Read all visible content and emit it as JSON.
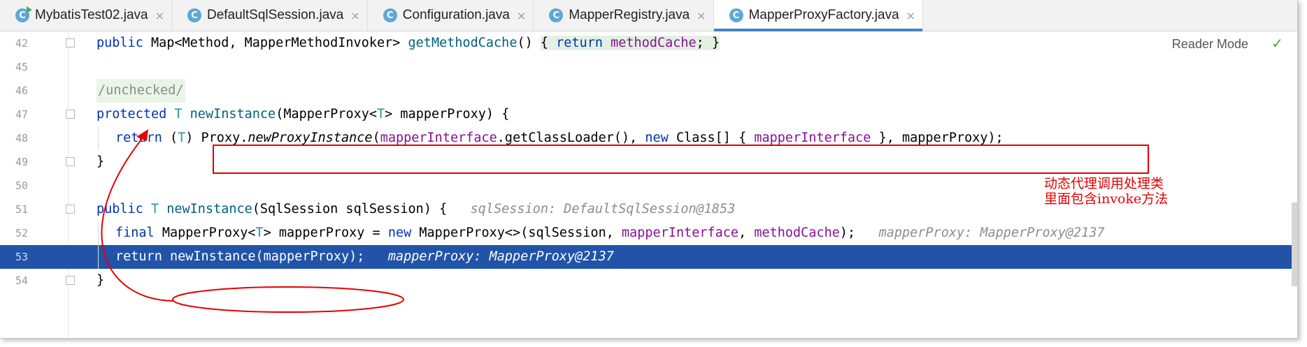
{
  "tabs": [
    {
      "label": "MybatisTest02.java",
      "active": false,
      "icon": "class-run-icon"
    },
    {
      "label": "DefaultSqlSession.java",
      "active": false,
      "icon": "class-icon"
    },
    {
      "label": "Configuration.java",
      "active": false,
      "icon": "class-icon"
    },
    {
      "label": "MapperRegistry.java",
      "active": false,
      "icon": "class-icon"
    },
    {
      "label": "MapperProxyFactory.java",
      "active": true,
      "icon": "class-icon"
    }
  ],
  "tab_icon_letter": "C",
  "tab_close_glyph": "×",
  "reader_mode": "Reader Mode",
  "inspection_icon": "check-icon",
  "lines": {
    "l42": {
      "num": "42",
      "a": "public ",
      "b": "Map<Method, MapperMethodInvoker> ",
      "c": "getMethodCache",
      "d": "() ",
      "e": "{ ",
      "f": "return ",
      "g": "methodCache",
      "h": "; }"
    },
    "l45": {
      "num": "45"
    },
    "l46": {
      "num": "46",
      "comment": "/unchecked/"
    },
    "l47": {
      "num": "47",
      "a": "protected ",
      "b": "T ",
      "c": "newInstance",
      "d": "(MapperProxy<",
      "e": "T",
      "f": "> mapperProxy) {"
    },
    "l48": {
      "num": "48",
      "a": "return ",
      "b": "(",
      "c": "T",
      "d": ") ",
      "e": "Proxy.",
      "f": "newProxyInstance",
      "g": "(",
      "h": "mapperInterface",
      "i": ".getClassLoader(), ",
      "j": "new ",
      "k": "Class[] { ",
      "l": "mapperInterface",
      "m": " }, mapperProxy);"
    },
    "l49": {
      "num": "49",
      "a": "}"
    },
    "l50": {
      "num": "50"
    },
    "l51": {
      "num": "51",
      "a": "public ",
      "b": "T ",
      "c": "newInstance",
      "d": "(SqlSession sqlSession) {",
      "hint": "sqlSession: DefaultSqlSession@1853"
    },
    "l52": {
      "num": "52",
      "a": "final ",
      "b": "MapperProxy<",
      "c": "T",
      "d": "> mapperProxy = ",
      "e": "new ",
      "f": "MapperProxy<>(sqlSession, ",
      "g": "mapperInterface",
      "h": ", ",
      "i": "methodCache",
      "j": ");",
      "hint": "mapperProxy: MapperProxy@2137"
    },
    "l53": {
      "num": "53",
      "a": "return ",
      "b": "newInstance(mapperProxy);",
      "hint": "mapperProxy: MapperProxy@2137"
    },
    "l54": {
      "num": "54",
      "a": "}"
    }
  },
  "annotation": {
    "line1": "动态代理调用处理类",
    "line2": "里面包含invoke方法",
    "color": "#e60000"
  },
  "colors": {
    "keyword": "#0033b3",
    "field": "#871094",
    "method": "#00627a",
    "type_param": "#20999d",
    "execution_line": "#2154a8"
  }
}
